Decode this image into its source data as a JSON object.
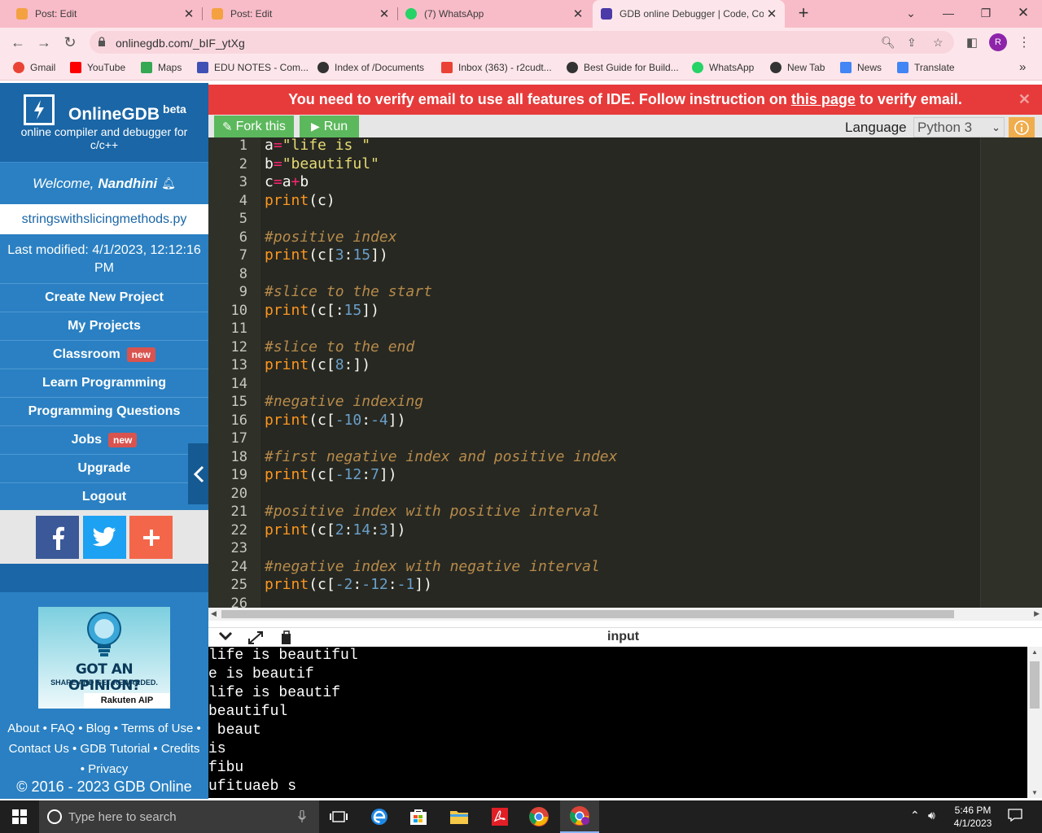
{
  "browser": {
    "tabs": [
      {
        "title": "Post: Edit",
        "color": "#f4a142"
      },
      {
        "title": "Post: Edit",
        "color": "#f4a142"
      },
      {
        "title": "(7) WhatsApp",
        "color": "#25d366"
      },
      {
        "title": "GDB online Debugger | Code, Co",
        "color": "#4b3aa8"
      }
    ],
    "url": "onlinegdb.com/_bIF_ytXg",
    "profile_initial": "R",
    "bookmarks": [
      {
        "label": "Gmail",
        "color": "#ea4335"
      },
      {
        "label": "YouTube",
        "color": "#ff0000"
      },
      {
        "label": "Maps",
        "color": "#34a853"
      },
      {
        "label": "EDU NOTES - Com...",
        "color": "#3f51b5"
      },
      {
        "label": "Index of /Documents",
        "color": "#333333"
      },
      {
        "label": "Inbox (363) - r2cudt...",
        "color": "#ea4335"
      },
      {
        "label": "Best Guide for Build...",
        "color": "#333333"
      },
      {
        "label": "WhatsApp",
        "color": "#25d366"
      },
      {
        "label": "New Tab",
        "color": "#333333"
      },
      {
        "label": "News",
        "color": "#4285f4"
      },
      {
        "label": "Translate",
        "color": "#4285f4"
      }
    ]
  },
  "sidebar": {
    "brand": "OnlineGDB",
    "brand_sup": "beta",
    "tagline": "online compiler and debugger for c/c++",
    "welcome_prefix": "Welcome,",
    "welcome_user": "Nandhini",
    "filename": "stringswithslicingmethods.py",
    "last_modified": "Last modified: 4/1/2023, 12:12:16 PM",
    "menu": [
      {
        "label": "Create New Project",
        "badge": ""
      },
      {
        "label": "My Projects",
        "badge": ""
      },
      {
        "label": "Classroom",
        "badge": "new"
      },
      {
        "label": "Learn Programming",
        "badge": ""
      },
      {
        "label": "Programming Questions",
        "badge": ""
      },
      {
        "label": "Jobs",
        "badge": "new"
      },
      {
        "label": "Upgrade",
        "badge": ""
      },
      {
        "label": "Logout",
        "badge": ""
      }
    ],
    "ad": {
      "title": "GOT AN OPINION?",
      "subtitle": "SHARE AND GET REWARDED.",
      "brand": "Rakuten AIP"
    },
    "footer_links_1": "About • FAQ • Blog • Terms of Use •",
    "footer_links_2": "Contact Us • GDB Tutorial • Credits",
    "footer_links_3": "• Privacy",
    "copyright": "© 2016 - 2023 GDB Online"
  },
  "banner": {
    "text_before": "You need to verify email to use all features of IDE. Follow instruction on",
    "link": "this page",
    "text_after": "to verify email."
  },
  "toolbar": {
    "fork_label": "Fork this",
    "run_label": "Run",
    "language_label": "Language",
    "language_value": "Python 3"
  },
  "editor": {
    "lines": [
      [
        [
          "id",
          "a"
        ],
        [
          "op",
          "="
        ],
        [
          "str",
          "\"life is \""
        ]
      ],
      [
        [
          "id",
          "b"
        ],
        [
          "op",
          "="
        ],
        [
          "str",
          "\"beautiful\""
        ]
      ],
      [
        [
          "id",
          "c"
        ],
        [
          "op",
          "="
        ],
        [
          "id",
          "a"
        ],
        [
          "op",
          "+"
        ],
        [
          "id",
          "b"
        ]
      ],
      [
        [
          "fn",
          "print"
        ],
        [
          "pu",
          "(c)"
        ]
      ],
      [],
      [
        [
          "cm",
          "#positive index"
        ]
      ],
      [
        [
          "fn",
          "print"
        ],
        [
          "pu",
          "(c["
        ],
        [
          "num",
          "3"
        ],
        [
          "pu",
          ":"
        ],
        [
          "num",
          "15"
        ],
        [
          "pu",
          "])"
        ]
      ],
      [],
      [
        [
          "cm",
          "#slice to the start"
        ]
      ],
      [
        [
          "fn",
          "print"
        ],
        [
          "pu",
          "(c[:"
        ],
        [
          "num",
          "15"
        ],
        [
          "pu",
          "])"
        ]
      ],
      [],
      [
        [
          "cm",
          "#slice to the end"
        ]
      ],
      [
        [
          "fn",
          "print"
        ],
        [
          "pu",
          "(c["
        ],
        [
          "num",
          "8"
        ],
        [
          "pu",
          ":])"
        ]
      ],
      [],
      [
        [
          "cm",
          "#negative indexing"
        ]
      ],
      [
        [
          "fn",
          "print"
        ],
        [
          "pu",
          "(c["
        ],
        [
          "num",
          "-10"
        ],
        [
          "pu",
          ":"
        ],
        [
          "num",
          "-4"
        ],
        [
          "pu",
          "])"
        ]
      ],
      [],
      [
        [
          "cm",
          "#first negative index and positive index"
        ]
      ],
      [
        [
          "fn",
          "print"
        ],
        [
          "pu",
          "(c["
        ],
        [
          "num",
          "-12"
        ],
        [
          "pu",
          ":"
        ],
        [
          "num",
          "7"
        ],
        [
          "pu",
          "])"
        ]
      ],
      [],
      [
        [
          "cm",
          "#positive index with positive interval"
        ]
      ],
      [
        [
          "fn",
          "print"
        ],
        [
          "pu",
          "(c["
        ],
        [
          "num",
          "2"
        ],
        [
          "pu",
          ":"
        ],
        [
          "num",
          "14"
        ],
        [
          "pu",
          ":"
        ],
        [
          "num",
          "3"
        ],
        [
          "pu",
          "])"
        ]
      ],
      [],
      [
        [
          "cm",
          "#negative index with negative interval"
        ]
      ],
      [
        [
          "fn",
          "print"
        ],
        [
          "pu",
          "(c["
        ],
        [
          "num",
          "-2"
        ],
        [
          "pu",
          ":"
        ],
        [
          "num",
          "-12"
        ],
        [
          "pu",
          ":"
        ],
        [
          "num",
          "-1"
        ],
        [
          "pu",
          "])"
        ]
      ],
      []
    ]
  },
  "io": {
    "label": "input",
    "output": [
      "life is beautiful",
      "e is beautif",
      "life is beautif",
      "beautiful",
      " beaut",
      "is",
      "fibu",
      "ufituaeb s"
    ]
  },
  "taskbar": {
    "search_placeholder": "Type here to search",
    "time": "5:46 PM",
    "date": "4/1/2023"
  }
}
